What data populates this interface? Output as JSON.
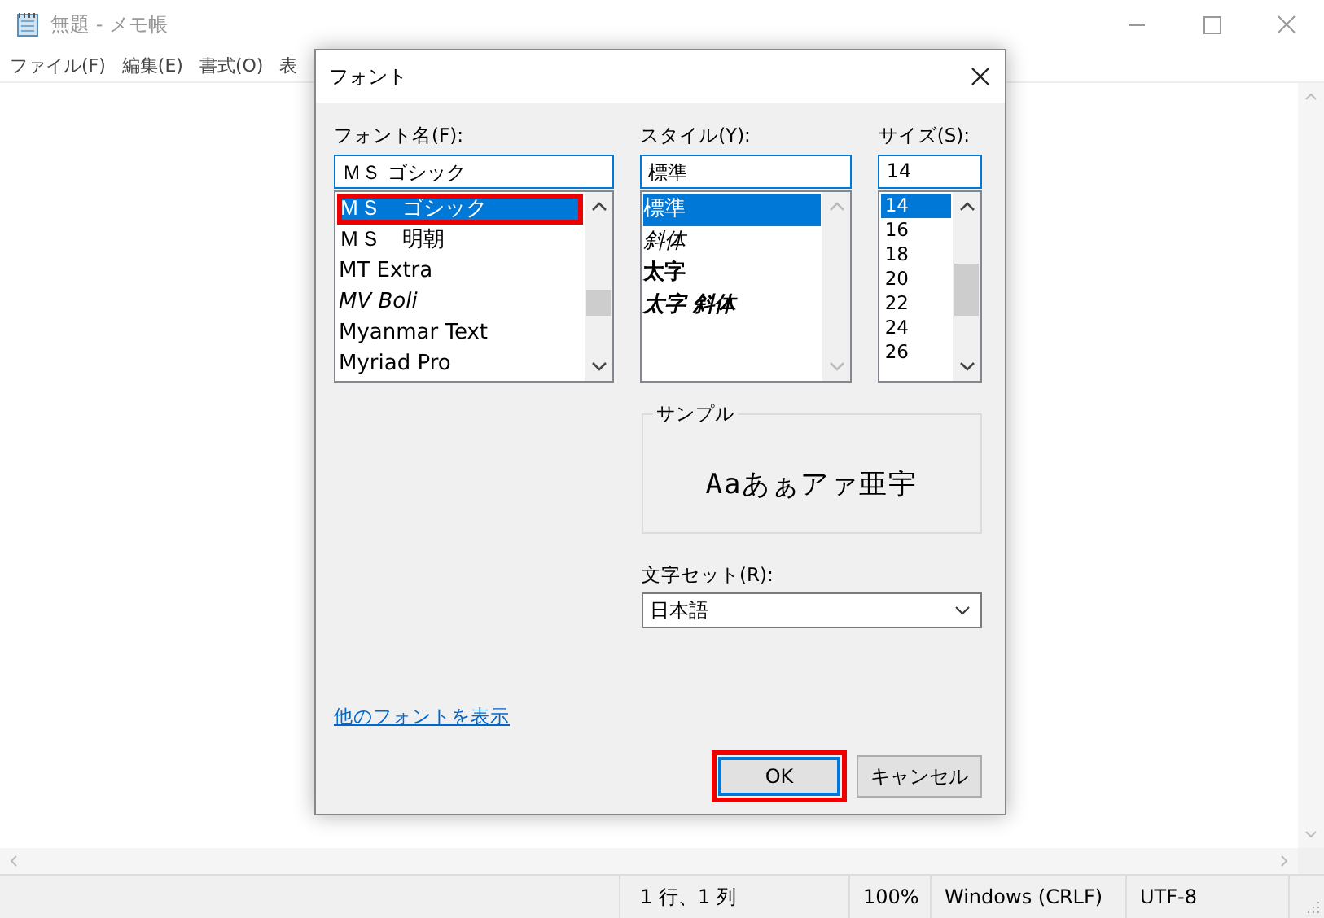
{
  "window": {
    "title": "無題 - メモ帳",
    "menu": [
      "ファイル(F)",
      "編集(E)",
      "書式(O)",
      "表"
    ]
  },
  "dialog": {
    "title": "フォント",
    "font_name": {
      "label": "フォント名(F):",
      "value": "ＭＳ ゴシック",
      "items": [
        {
          "text": "ＭＳ　ゴシック",
          "kind": "regular",
          "selected": true,
          "highlighted": true
        },
        {
          "text": "ＭＳ　明朝",
          "kind": "serif",
          "selected": false,
          "highlighted": false
        },
        {
          "text": "MT Extra",
          "kind": "regular",
          "selected": false,
          "highlighted": false
        },
        {
          "text": "MV Boli",
          "kind": "italic",
          "selected": false,
          "highlighted": false
        },
        {
          "text": "Myanmar Text",
          "kind": "regular",
          "selected": false,
          "highlighted": false
        },
        {
          "text": "Myriad Pro",
          "kind": "regular",
          "selected": false,
          "highlighted": false
        }
      ]
    },
    "style": {
      "label": "スタイル(Y):",
      "value": "標準",
      "items": [
        {
          "text": "標準",
          "kind": "regular",
          "selected": true
        },
        {
          "text": "斜体",
          "kind": "italic",
          "selected": false
        },
        {
          "text": "太字",
          "kind": "bold",
          "selected": false
        },
        {
          "text": "太字 斜体",
          "kind": "bold-italic",
          "selected": false
        }
      ]
    },
    "size": {
      "label": "サイズ(S):",
      "value": "14",
      "items": [
        {
          "text": "14",
          "selected": true
        },
        {
          "text": "16",
          "selected": false
        },
        {
          "text": "18",
          "selected": false
        },
        {
          "text": "20",
          "selected": false
        },
        {
          "text": "22",
          "selected": false
        },
        {
          "text": "24",
          "selected": false
        },
        {
          "text": "26",
          "selected": false
        }
      ]
    },
    "sample": {
      "label": "サンプル",
      "text": "Aaあぁアァ亜宇"
    },
    "charset": {
      "label": "文字セット(R):",
      "value": "日本語"
    },
    "link": "他のフォントを表示",
    "buttons": [
      {
        "label": "OK",
        "default": true,
        "highlighted": true
      },
      {
        "label": "キャンセル",
        "default": false,
        "highlighted": false
      }
    ]
  },
  "status_bar": [
    "1 行、1 列",
    "100%",
    "Windows (CRLF)",
    "UTF-8"
  ]
}
